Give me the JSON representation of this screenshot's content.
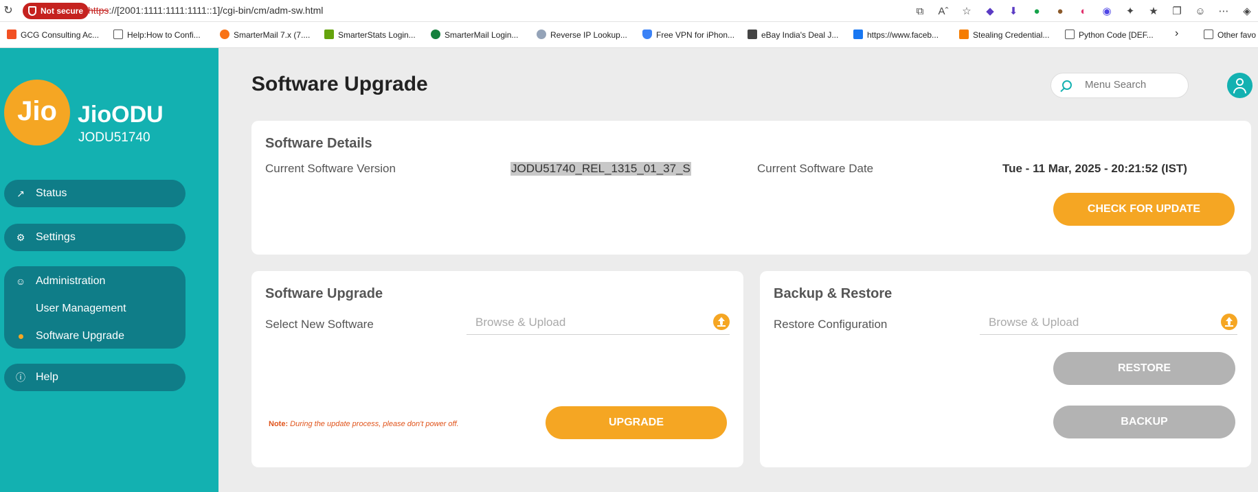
{
  "browser": {
    "security_label": "Not secure",
    "url_protocol": "https",
    "url_rest": "://[2001:1111:1111:1111::1]/cgi-bin/cm/adm-sw.html",
    "bookmarks": [
      {
        "label": "GCG Consulting Ac..."
      },
      {
        "label": "Help:How to Confi..."
      },
      {
        "label": "SmarterMail 7.x (7...."
      },
      {
        "label": "SmarterStats Login..."
      },
      {
        "label": "SmarterMail Login..."
      },
      {
        "label": "Reverse IP Lookup..."
      },
      {
        "label": "Free VPN for iPhon..."
      },
      {
        "label": "eBay India's Deal J..."
      },
      {
        "label": "https://www.faceb..."
      },
      {
        "label": "Stealing Credential..."
      },
      {
        "label": "Python Code [DEF..."
      },
      {
        "label": "Other favo"
      }
    ]
  },
  "sidebar": {
    "logo_text": "Jio",
    "brand": "JioODU",
    "serial": "JODU51740",
    "nav": {
      "status": "Status",
      "settings": "Settings",
      "administration": "Administration",
      "user_management": "User Management",
      "software_upgrade": "Software Upgrade",
      "help": "Help"
    }
  },
  "header": {
    "title": "Software Upgrade",
    "search_placeholder": "Menu Search"
  },
  "software_details": {
    "title": "Software Details",
    "version_label": "Current Software Version",
    "version_value": "JODU51740_REL_1315_01_37_S",
    "date_label": "Current Software Date",
    "date_value": "Tue - 11 Mar, 2025 - 20:21:52 (IST)",
    "check_button": "CHECK FOR UPDATE"
  },
  "software_upgrade": {
    "title": "Software Upgrade",
    "select_label": "Select New Software",
    "upload_placeholder": "Browse & Upload",
    "note_prefix": "Note:",
    "note_text": "During the update process, please don't power off.",
    "upgrade_button": "UPGRADE"
  },
  "backup_restore": {
    "title": "Backup & Restore",
    "restore_label": "Restore Configuration",
    "upload_placeholder": "Browse & Upload",
    "restore_button": "RESTORE",
    "backup_button": "BACKUP"
  },
  "colors": {
    "sidebar": "#13b1b1",
    "nav_pill": "#0f7d88",
    "accent": "#f5a623",
    "disabled": "#b3b3b3"
  }
}
